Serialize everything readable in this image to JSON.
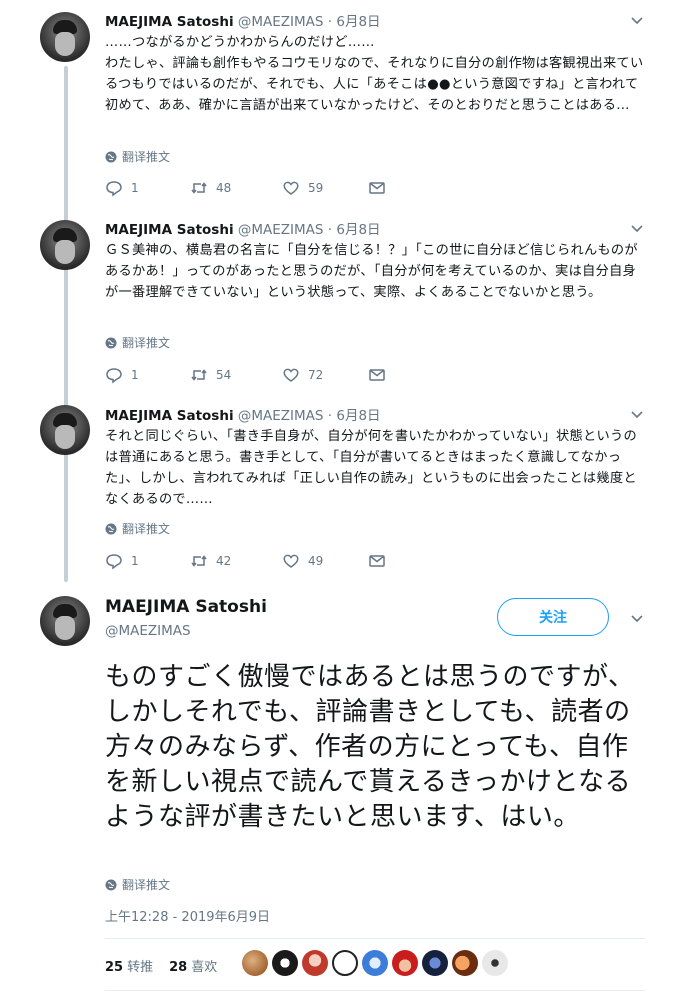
{
  "author": {
    "name": "MAEJIMA Satoshi",
    "handle": "@MAEZIMAS"
  },
  "thread": [
    {
      "date": "· 6月8日",
      "text": "……つながるかどうかわからんのだけど……\nわたしゃ、評論も創作もやるコウモリなので、それなりに自分の創作物は客観視出来ているつもりではいるのだが、それでも、人に「あそこは●●という意図ですね」と言われて初めて、ああ、確かに言語が出来ていなかったけど、そのとおりだと思うことはある…",
      "translate": "翻译推文",
      "replies": "1",
      "retweets": "48",
      "likes": "59"
    },
    {
      "date": "· 6月8日",
      "text": "ＧＳ美神の、横島君の名言に「自分を信じる！？」「この世に自分ほど信じられんものがあるかあ！」ってのがあったと思うのだが、「自分が何を考えているのか、実は自分自身が一番理解できていない」という状態って、実際、よくあることでないかと思う。",
      "translate": "翻译推文",
      "replies": "1",
      "retweets": "54",
      "likes": "72"
    },
    {
      "date": "· 6月8日",
      "text": "それと同じぐらい、「書き手自身が、自分が何を書いたかわかっていない」状態というのは普通にあると思う。書き手として、「自分が書いてるときはまったく意識してなかった」、しかし、言われてみれば「正しい自作の読み」というものに出会ったことは幾度となくあるので……",
      "translate": "翻译推文",
      "replies": "1",
      "retweets": "42",
      "likes": "49"
    }
  ],
  "main": {
    "follow_label": "关注",
    "text": "ものすごく傲慢ではあるとは思うのですが、しかしそれでも、評論書きとしても、読者の方々のみならず、作者の方にとっても、自作を新しい視点で読んで貰えるきっかけとなるような評が書きたいと思います、はい。",
    "translate": "翻译推文",
    "timestamp": "上午12:28 - 2019年6月9日",
    "retweet_count": "25",
    "retweet_label": "转推",
    "like_count": "28",
    "like_label": "喜欢"
  },
  "icons": {
    "reply": "reply-icon",
    "retweet": "retweet-icon",
    "like": "heart-icon",
    "message": "envelope-icon",
    "globe": "globe-icon",
    "chevron": "chevron-down-icon"
  },
  "colors": {
    "accent": "#1da1f2",
    "secondary_text": "#657786",
    "thread_line": "#c4cfd6"
  }
}
